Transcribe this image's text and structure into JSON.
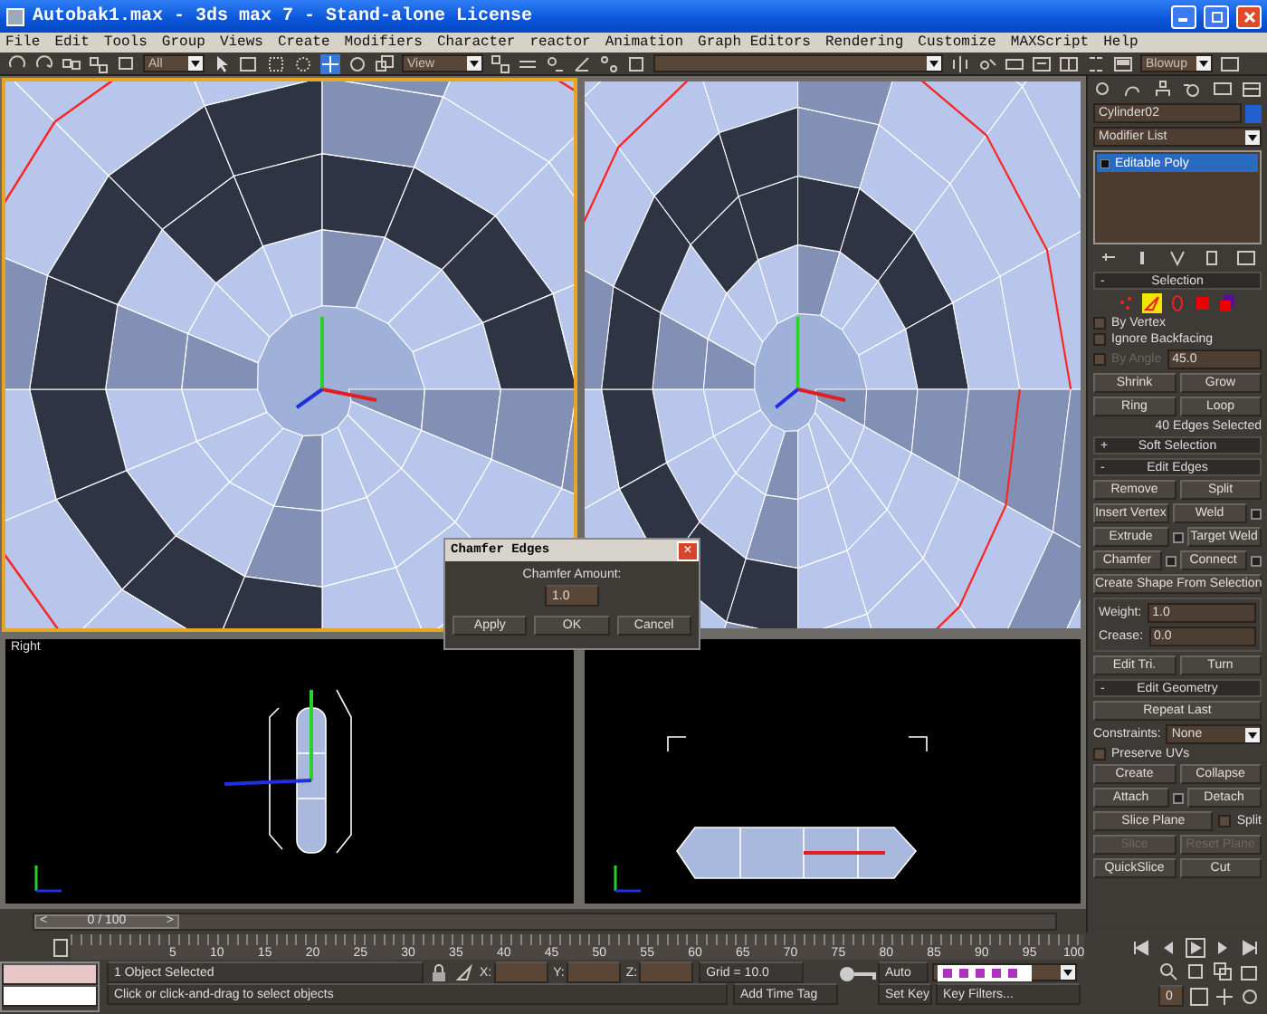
{
  "window": {
    "title": "Autobak1.max - 3ds max 7  - Stand-alone License"
  },
  "menu": [
    "File",
    "Edit",
    "Tools",
    "Group",
    "Views",
    "Create",
    "Modifiers",
    "Character",
    "reactor",
    "Animation",
    "Graph Editors",
    "Rendering",
    "Customize",
    "MAXScript",
    "Help"
  ],
  "toolbar": {
    "selection_filter": "All",
    "reference_coord": "View",
    "render_type": "Blowup"
  },
  "viewports": [
    {
      "kind": "spiral-front",
      "active": true
    },
    {
      "kind": "spiral-persp",
      "active": false
    },
    {
      "kind": "cylinder-side",
      "label": "Right",
      "active": false
    },
    {
      "kind": "cylinder-top",
      "active": false
    }
  ],
  "dialog": {
    "title": "Chamfer Edges",
    "close": "×",
    "label": "Chamfer Amount:",
    "value": "1.0",
    "buttons": [
      "Apply",
      "OK",
      "Cancel"
    ]
  },
  "command_panel": {
    "object_name": "Cylinder02",
    "modifier_list": "Modifier List",
    "stack": [
      {
        "label": "Editable Poly",
        "selected": true
      }
    ],
    "selection": {
      "toggle": "-",
      "title": "Selection",
      "subobjects": [
        {
          "kind": "vertex",
          "selected": false
        },
        {
          "kind": "edge",
          "selected": true
        },
        {
          "kind": "border",
          "selected": false
        },
        {
          "kind": "polygon",
          "selected": false
        },
        {
          "kind": "element",
          "selected": false
        }
      ],
      "checks": [
        {
          "label": "By Vertex",
          "checked": false,
          "disabled": false
        },
        {
          "label": "Ignore Backfacing",
          "checked": false,
          "disabled": false
        },
        {
          "label": "By Angle",
          "checked": false,
          "disabled": true,
          "value": "45.0"
        }
      ],
      "buttons": [
        "Shrink",
        "Grow",
        "Ring",
        "Loop"
      ],
      "status": "40 Edges Selected"
    },
    "soft_selection": {
      "toggle": "+",
      "title": "Soft Selection"
    },
    "edit_edges": {
      "toggle": "-",
      "title": "Edit Edges",
      "buttons": [
        {
          "label": "Remove",
          "settings": false
        },
        {
          "label": "Split",
          "settings": false
        },
        {
          "label": "Insert Vertex",
          "settings": false
        },
        {
          "label": "Weld",
          "settings": true
        },
        {
          "label": "Extrude",
          "settings": true
        },
        {
          "label": "Target Weld",
          "settings": false
        },
        {
          "label": "Chamfer",
          "settings": true
        },
        {
          "label": "Connect",
          "settings": true
        }
      ],
      "wide_button": "Create Shape From Selection",
      "spinners": [
        {
          "label": "Weight:",
          "value": "1.0"
        },
        {
          "label": "Crease:",
          "value": "0.0"
        }
      ],
      "bottom_buttons": [
        "Edit Tri.",
        "Turn"
      ]
    },
    "edit_geometry": {
      "toggle": "-",
      "title": "Edit Geometry",
      "repeat": "Repeat Last",
      "constraints": {
        "label": "Constraints:",
        "value": "None"
      },
      "preserve_uvs": {
        "label": "Preserve UVs",
        "checked": false
      },
      "buttons": [
        {
          "label": "Create",
          "settings": false
        },
        {
          "label": "Collapse",
          "settings": false
        },
        {
          "label": "Attach",
          "settings": true
        },
        {
          "label": "Detach",
          "settings": false
        }
      ],
      "slice_plane": "Slice Plane",
      "split": {
        "label": "Split",
        "checked": false
      },
      "slice_buttons": [
        {
          "label": "Slice",
          "disabled": true
        },
        {
          "label": "Reset Plane",
          "disabled": true
        },
        {
          "label": "QuickSlice",
          "disabled": false
        },
        {
          "label": "Cut",
          "disabled": false
        }
      ]
    }
  },
  "time_slider": {
    "prev": "<",
    "frame": "0 / 100",
    "next": ">",
    "level": 0
  },
  "track_bar": {
    "ticks": [
      "5",
      "10",
      "15",
      "20",
      "25",
      "30",
      "35",
      "40",
      "45",
      "50",
      "55",
      "60",
      "65",
      "70",
      "75",
      "80",
      "85",
      "90",
      "95",
      "100"
    ]
  },
  "status_bar": {
    "selection": "1 Object Selected",
    "prompt": "Click or click-and-drag to select objects",
    "coords": [
      "X:",
      "Y:",
      "Z:"
    ],
    "grid": "Grid = 10.0",
    "time_tag": "Add Time Tag",
    "auto_key": "Auto",
    "set_key": "Set Key",
    "key_filters": "Key Filters...",
    "current_frame": "0"
  }
}
